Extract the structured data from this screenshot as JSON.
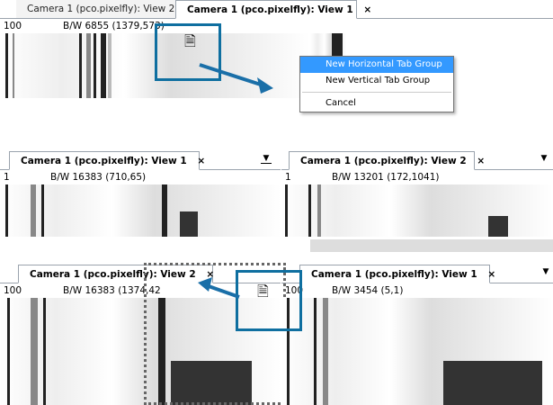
{
  "panels": {
    "top": {
      "tabs": [
        {
          "label": "Camera 1 (pco.pixelfly): View 2"
        },
        {
          "label": "Camera 1 (pco.pixelfly): View 1",
          "close": "×"
        }
      ],
      "zoom": "100",
      "pixel_info": "B/W 6855 (1379,573)"
    },
    "mid_left": {
      "tab": {
        "label": "Camera 1 (pco.pixelfly): View 1",
        "close": "×"
      },
      "dropdown": "▼",
      "zoom": "1",
      "pixel_info": "B/W 16383 (710,65)"
    },
    "mid_right": {
      "tab": {
        "label": "Camera 1 (pco.pixelfly): View 2",
        "close": "×"
      },
      "dropdown": "▼",
      "zoom": "1",
      "pixel_info": "B/W 13201 (172,1041)"
    },
    "bottom_left": {
      "tab": {
        "label": "Camera 1 (pco.pixelfly): View 2",
        "close": "×"
      },
      "zoom": "100",
      "pixel_info": "B/W 16383 (1374,42"
    },
    "bottom_right": {
      "tab": {
        "label": "Camera 1 (pco.pixelfly): View 1",
        "close": "×"
      },
      "dropdown": "▼",
      "zoom": "100",
      "pixel_info": "B/W 3454 (5,1)"
    }
  },
  "context_menu": {
    "items": [
      {
        "label": "New Horizontal Tab Group",
        "selected": true
      },
      {
        "label": "New Vertical Tab Group",
        "selected": false
      },
      {
        "separator": true
      },
      {
        "label": "Cancel",
        "selected": false
      }
    ]
  },
  "colors": {
    "highlight": "#0f6fa0",
    "arrow": "#1a6fa8",
    "menu_selection": "#3399ff"
  },
  "icons": {
    "drag_cursor": "document-drag-icon",
    "arrow": "arrow-icon"
  }
}
